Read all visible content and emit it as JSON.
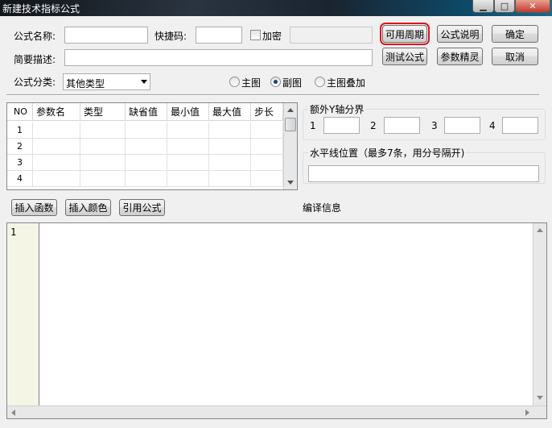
{
  "window": {
    "title": "新建技术指标公式",
    "minimize_glyph": "▁",
    "maximize_glyph": "□",
    "close_glyph": "✕"
  },
  "form": {
    "name_label": "公式名称:",
    "name_value": "",
    "shortcut_label": "快捷码:",
    "shortcut_value": "",
    "encrypt_label": "加密",
    "encrypt_checked": false,
    "password_value": "",
    "desc_label": "简要描述:",
    "desc_value": "",
    "category_label": "公式分类:",
    "category_value": "其他类型"
  },
  "buttons": {
    "periods": "可用周期",
    "formula_help": "公式说明",
    "ok": "确定",
    "test": "测试公式",
    "param_wizard": "参数精灵",
    "cancel": "取消",
    "insert_function": "插入函数",
    "insert_color": "插入颜色",
    "reference_formula": "引用公式"
  },
  "chart_type": {
    "options": [
      "主图",
      "副图",
      "主图叠加"
    ],
    "selected": "副图"
  },
  "params_table": {
    "headers": [
      "NO",
      "参数名",
      "类型",
      "缺省值",
      "最小值",
      "最大值",
      "步长"
    ],
    "rows": [
      [
        "1",
        "",
        "",
        "",
        "",
        "",
        ""
      ],
      [
        "2",
        "",
        "",
        "",
        "",
        "",
        ""
      ],
      [
        "3",
        "",
        "",
        "",
        "",
        "",
        ""
      ],
      [
        "4",
        "",
        "",
        "",
        "",
        "",
        ""
      ]
    ]
  },
  "extra_y_axis": {
    "title": "额外Y轴分界",
    "labels": [
      "1",
      "2",
      "3",
      "4"
    ],
    "values": [
      "",
      "",
      "",
      ""
    ]
  },
  "hline": {
    "title": "水平线位置（最多7条，用分号隔开)",
    "value": ""
  },
  "compile_info_label": "编译信息",
  "editor": {
    "line_numbers": [
      "1"
    ],
    "content": ""
  },
  "colors": {
    "highlight": "#e0141e",
    "gutter": "#f5f5e6"
  }
}
